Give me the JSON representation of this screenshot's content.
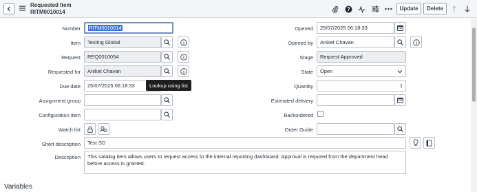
{
  "header": {
    "title": "Requested Item",
    "subtitle": "RITM0010014",
    "update_label": "Update",
    "delete_label": "Delete",
    "icons": [
      "paperclip-icon",
      "help-icon",
      "activity-icon",
      "settings-sliders-icon",
      "more-icon",
      "arrow-up-icon",
      "arrow-down-icon"
    ]
  },
  "form": {
    "number": {
      "label": "Number",
      "value": "RITM0010014"
    },
    "item": {
      "label": "Item",
      "value": "Testing Global"
    },
    "request": {
      "label": "Request",
      "value": "REQ0010054"
    },
    "requested_for": {
      "label": "Requested for",
      "value": "Aniket Chavan"
    },
    "due_date": {
      "label": "Due date",
      "value": "25/07/2025 06:18:33"
    },
    "assignment_group": {
      "label": "Assignment group",
      "value": ""
    },
    "configuration_item": {
      "label": "Configuration item",
      "value": ""
    },
    "watch_list": {
      "label": "Watch list"
    },
    "short_description": {
      "label": "Short description",
      "value": "Test SD"
    },
    "description": {
      "label": "Description",
      "value": "This catalog item allows users to request access to the internal reporting dashboard. Approval is required from the department head before access is granted."
    },
    "opened": {
      "label": "Opened",
      "value": "25/07/2025 06:18:33"
    },
    "opened_by": {
      "label": "Opened by",
      "value": "Aniket Chavan"
    },
    "stage": {
      "label": "Stage",
      "value": "Request Approved"
    },
    "state": {
      "label": "State",
      "value": "Open"
    },
    "quantity": {
      "label": "Quantity",
      "value": "1"
    },
    "estimated_delivery": {
      "label": "Estimated delivery",
      "value": ""
    },
    "backordered": {
      "label": "Backordered",
      "checked": false
    },
    "order_guide": {
      "label": "Order Guide",
      "value": ""
    }
  },
  "tooltip": {
    "text": "Lookup using list"
  },
  "sections": {
    "variables": "Variables"
  },
  "colors": {
    "accent": "#3a76d8",
    "header_bg": "#f4f5f7",
    "readonly_bg": "#eceef1"
  }
}
